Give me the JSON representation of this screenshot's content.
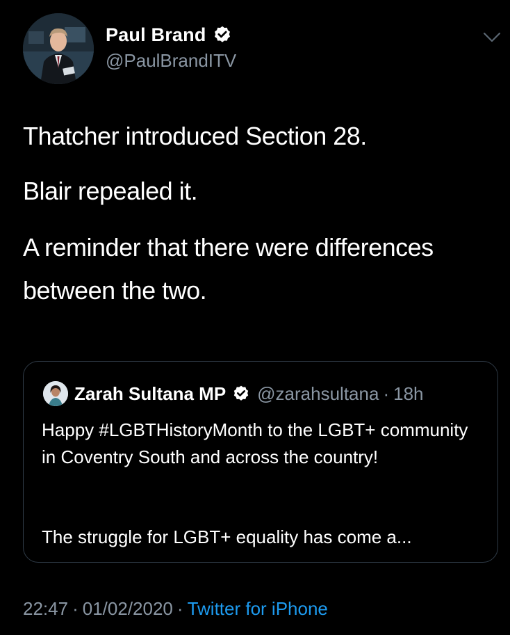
{
  "author": {
    "name": "Paul Brand",
    "handle": "@PaulBrandITV",
    "avatar_icon": "profile-photo",
    "verified": true
  },
  "tweet": {
    "paragraphs": [
      "Thatcher introduced Section 28.",
      "Blair repealed it.",
      "A reminder that there were differences",
      "between the two."
    ]
  },
  "quoted_tweet": {
    "name": "Zarah Sultana MP",
    "handle": "@zarahsultana",
    "separator": "·",
    "time": "18h",
    "verified": true,
    "text_1": "Happy #LGBTHistoryMonth to the LGBT+ community in Coventry South and across the country!",
    "text_2": "The struggle for LGBT+ equality has come a..."
  },
  "footer": {
    "time": "22:47",
    "separator": "·",
    "date": "01/02/2020",
    "source": "Twitter for iPhone"
  },
  "colors": {
    "background": "#000000",
    "text": "#ffffff",
    "secondary": "#8a96a3",
    "link": "#1d9bf0",
    "border": "#2f3b47"
  }
}
